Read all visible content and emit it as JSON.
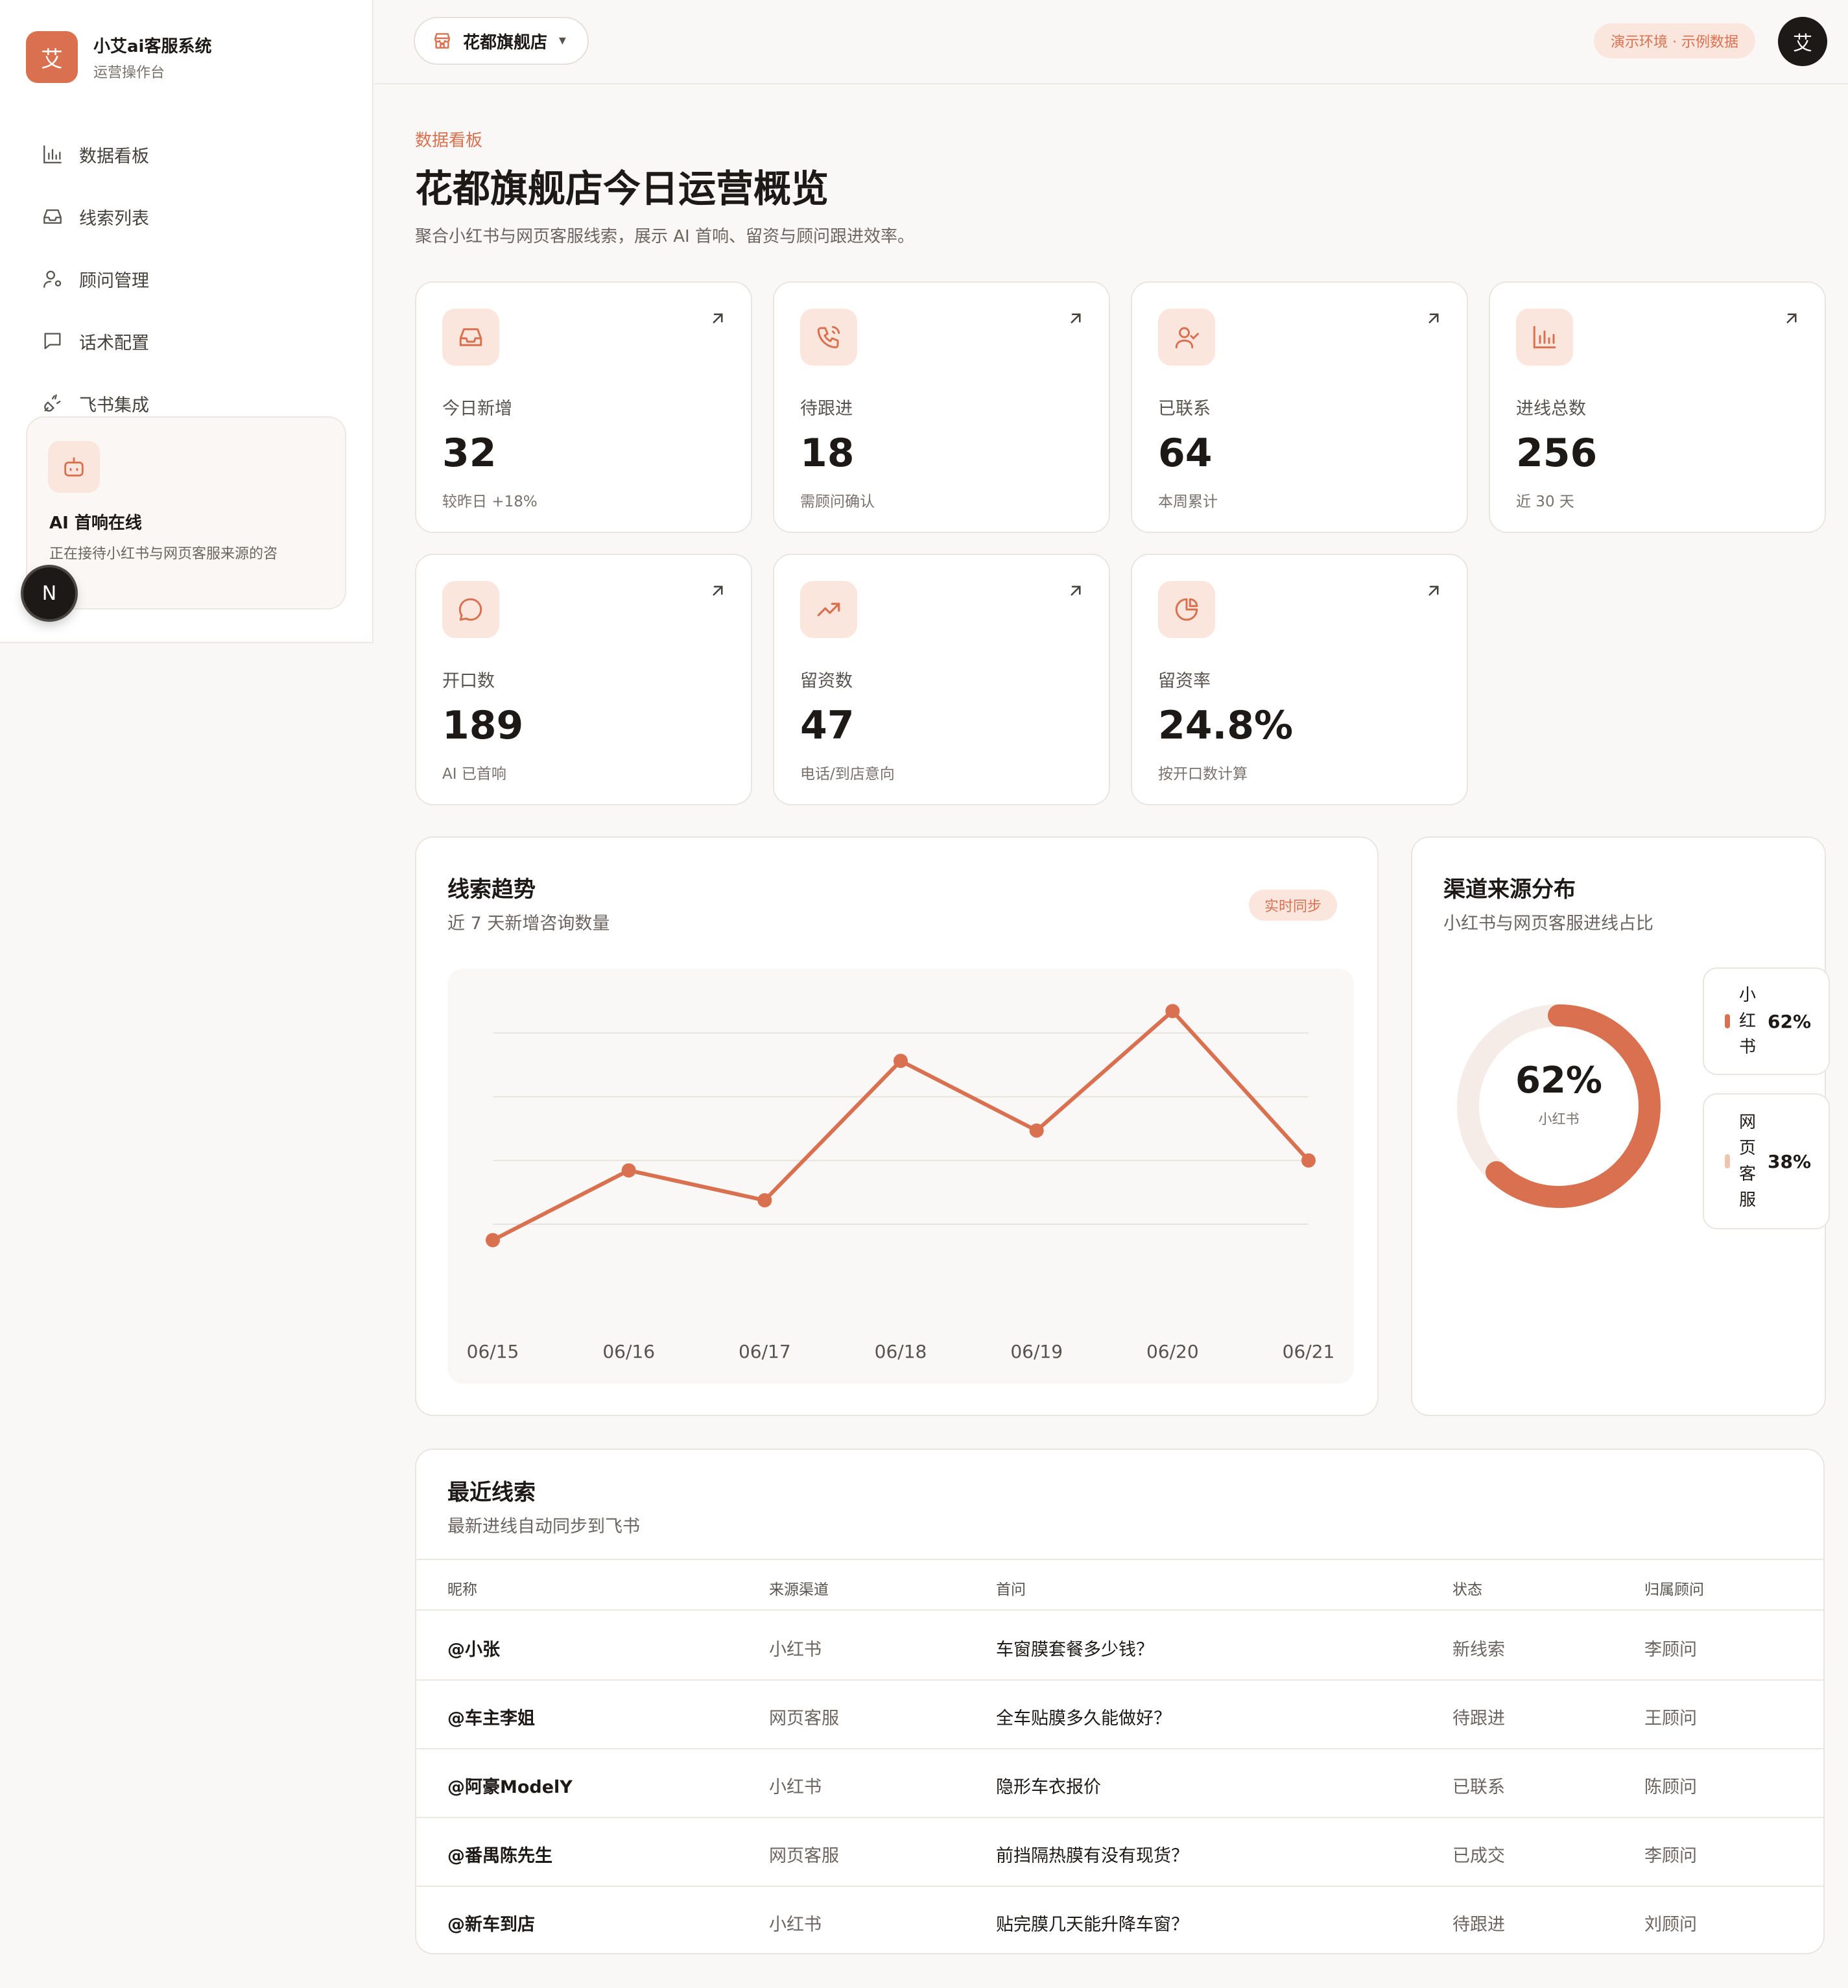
{
  "brand": {
    "logo": "艾",
    "title": "小艾ai客服系统",
    "subtitle": "运营操作台"
  },
  "nav": [
    {
      "label": "数据看板",
      "icon": "bar-chart-icon"
    },
    {
      "label": "线索列表",
      "icon": "inbox-icon"
    },
    {
      "label": "顾问管理",
      "icon": "user-gear-icon"
    },
    {
      "label": "话术配置",
      "icon": "message-square-icon"
    },
    {
      "label": "飞书集成",
      "icon": "plug-icon"
    }
  ],
  "ai_card": {
    "title": "AI 首响在线",
    "desc": "正在接待小红书与网页客服来源的咨"
  },
  "n_badge": "N",
  "header": {
    "store": "花都旗舰店",
    "env_badge": "演示环境 · 示例数据",
    "avatar": "艾"
  },
  "page": {
    "eyebrow": "数据看板",
    "title": "花都旗舰店今日运营概览",
    "desc": "聚合小红书与网页客服线索，展示 AI 首响、留资与顾问跟进效率。"
  },
  "metrics": [
    {
      "label": "今日新增",
      "value": "32",
      "note": "较昨日 +18%",
      "icon": "inbox-icon"
    },
    {
      "label": "待跟进",
      "value": "18",
      "note": "需顾问确认",
      "icon": "phone-icon"
    },
    {
      "label": "已联系",
      "value": "64",
      "note": "本周累计",
      "icon": "user-check-icon"
    },
    {
      "label": "进线总数",
      "value": "256",
      "note": "近 30 天",
      "icon": "bar-chart-icon"
    },
    {
      "label": "开口数",
      "value": "189",
      "note": "AI 已首响",
      "icon": "chat-bubble-icon"
    },
    {
      "label": "留资数",
      "value": "47",
      "note": "电话/到店意向",
      "icon": "trending-up-icon"
    },
    {
      "label": "留资率",
      "value": "24.8%",
      "note": "按开口数计算",
      "icon": "pie-chart-icon"
    }
  ],
  "trend": {
    "title": "线索趋势",
    "subtitle": "近 7 天新增咨询数量",
    "badge": "实时同步"
  },
  "chart_data": {
    "type": "line",
    "x": [
      "06/15",
      "06/16",
      "06/17",
      "06/18",
      "06/19",
      "06/20",
      "06/21"
    ],
    "series": [
      {
        "values": [
          18,
          25,
          22,
          36,
          29,
          41,
          26
        ]
      }
    ],
    "ylim": [
      14,
      42
    ],
    "grid": true,
    "color": "#d9704f"
  },
  "channel": {
    "title": "渠道来源分布",
    "subtitle": "小红书与网页客服进线占比",
    "center_value": "62%",
    "center_label": "小红书",
    "items": [
      {
        "name": "小红书",
        "pct": "62%",
        "value": 62,
        "color": "#d9704f"
      },
      {
        "name": "网页客服",
        "pct": "38%",
        "value": 38,
        "color": "#f5ece7"
      }
    ]
  },
  "recent": {
    "title": "最近线索",
    "subtitle": "最新进线自动同步到飞书",
    "columns": [
      "昵称",
      "来源渠道",
      "首问",
      "状态",
      "归属顾问"
    ],
    "rows": [
      {
        "name": "@小张",
        "channel": "小红书",
        "question": "车窗膜套餐多少钱？",
        "status": "新线索",
        "advisor": "李顾问"
      },
      {
        "name": "@车主李姐",
        "channel": "网页客服",
        "question": "全车贴膜多久能做好？",
        "status": "待跟进",
        "advisor": "王顾问"
      },
      {
        "name": "@阿豪ModelY",
        "channel": "小红书",
        "question": "隐形车衣报价",
        "status": "已联系",
        "advisor": "陈顾问"
      },
      {
        "name": "@番禺陈先生",
        "channel": "网页客服",
        "question": "前挡隔热膜有没有现货？",
        "status": "已成交",
        "advisor": "李顾问"
      },
      {
        "name": "@新车到店",
        "channel": "小红书",
        "question": "贴完膜几天能升降车窗？",
        "status": "待跟进",
        "advisor": "刘顾问"
      }
    ]
  }
}
